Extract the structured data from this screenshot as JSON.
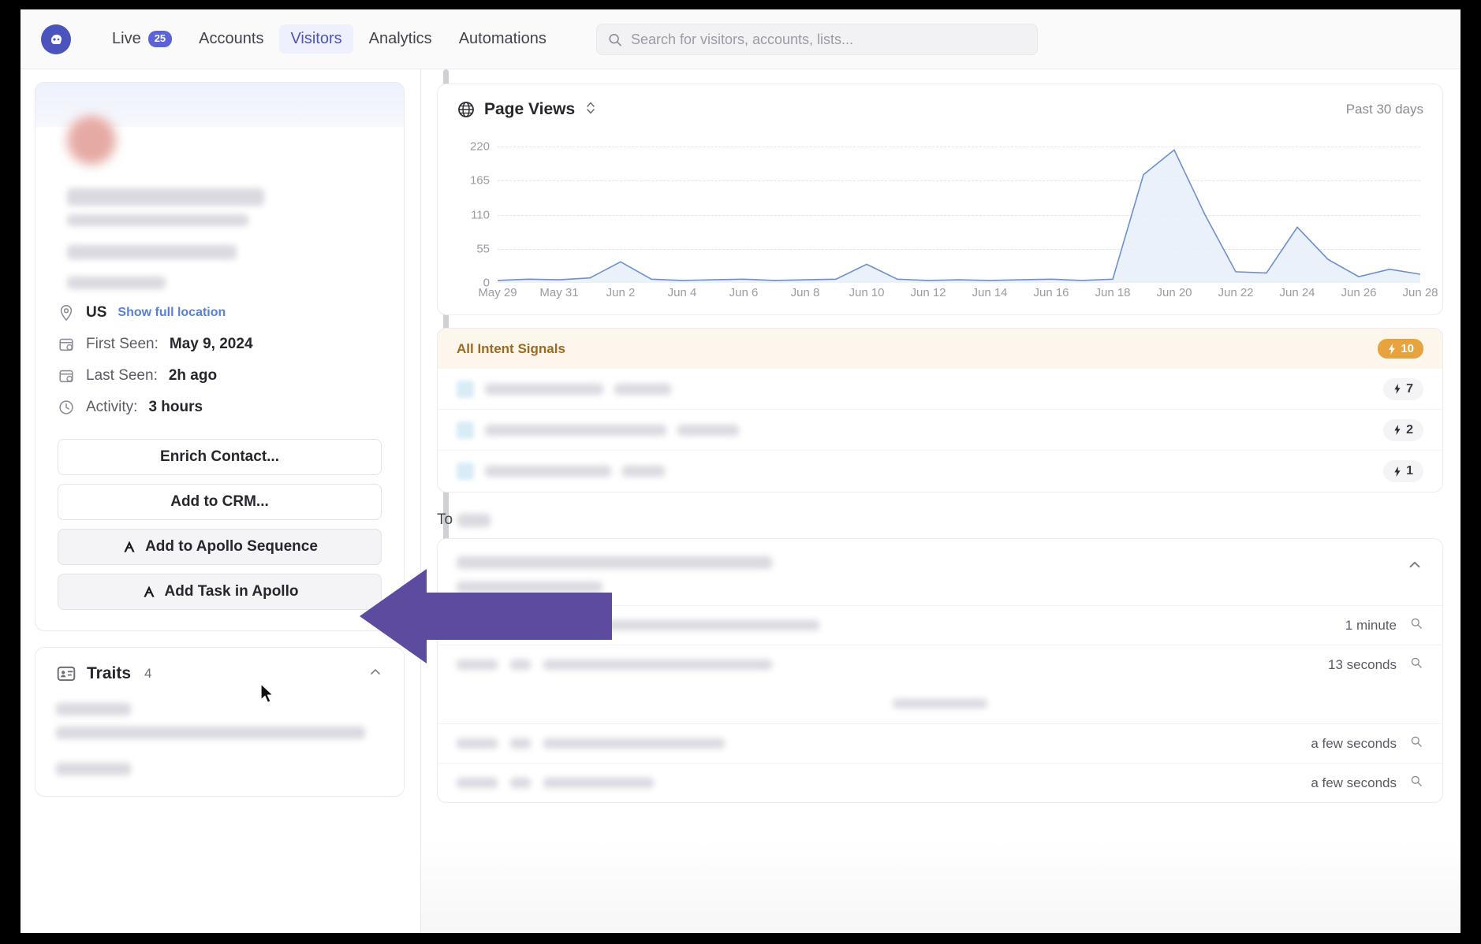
{
  "nav": {
    "logo_icon": "apollo-hippo-logo",
    "items": [
      {
        "label": "Live",
        "badge": "25",
        "active": false
      },
      {
        "label": "Accounts",
        "active": false
      },
      {
        "label": "Visitors",
        "active": true
      },
      {
        "label": "Analytics",
        "active": false
      },
      {
        "label": "Automations",
        "active": false
      }
    ],
    "search": {
      "icon": "search-icon",
      "placeholder": "Search for visitors, accounts, lists...",
      "value": ""
    }
  },
  "profile": {
    "location_icon": "map-pin-icon",
    "country": "US",
    "show_location_link": "Show full location",
    "first_seen_label": "First Seen:",
    "first_seen_value": "May 9, 2024",
    "last_seen_label": "Last Seen:",
    "last_seen_value": "2h ago",
    "activity_label": "Activity:",
    "activity_value": "3 hours",
    "calendar_icon": "calendar-clock-icon",
    "clock_icon": "clock-icon"
  },
  "actions": [
    {
      "label": "Enrich Contact...",
      "icon": null,
      "shaded": false
    },
    {
      "label": "Add to CRM...",
      "icon": null,
      "shaded": false
    },
    {
      "label": "Add to Apollo Sequence",
      "icon": "apollo-logo-icon",
      "shaded": true
    },
    {
      "label": "Add Task in Apollo",
      "icon": "apollo-logo-icon",
      "shaded": true
    }
  ],
  "traits": {
    "icon": "contact-card-icon",
    "title": "Traits",
    "count": "4",
    "collapse_icon": "chevron-up-icon"
  },
  "chart_card": {
    "icon": "globe-icon",
    "title": "Page Views",
    "sort_icon": "chevron-updown-icon",
    "range_label": "Past 30 days"
  },
  "chart_data": {
    "type": "area",
    "title": "Page Views",
    "subtitle": "Past 30 days",
    "xlabel": "",
    "ylabel": "",
    "ylim": [
      0,
      242
    ],
    "yticks": [
      0,
      55,
      110,
      165,
      220
    ],
    "grid": true,
    "legend": "none",
    "line_color": "#6c8fd0",
    "fill_color": "#e8eef9",
    "categories": [
      "May 29",
      "May 30",
      "May 31",
      "Jun 1",
      "Jun 2",
      "Jun 3",
      "Jun 4",
      "Jun 5",
      "Jun 6",
      "Jun 7",
      "Jun 8",
      "Jun 9",
      "Jun 10",
      "Jun 11",
      "Jun 12",
      "Jun 13",
      "Jun 14",
      "Jun 15",
      "Jun 16",
      "Jun 17",
      "Jun 18",
      "Jun 19",
      "Jun 20",
      "Jun 21",
      "Jun 22",
      "Jun 23",
      "Jun 24",
      "Jun 25",
      "Jun 26",
      "Jun 27",
      "Jun 28"
    ],
    "tick_labels": [
      "May 29",
      "May 31",
      "Jun 2",
      "Jun 4",
      "Jun 6",
      "Jun 8",
      "Jun 10",
      "Jun 12",
      "Jun 14",
      "Jun 16",
      "Jun 18",
      "Jun 20",
      "Jun 22",
      "Jun 24",
      "Jun 26",
      "Jun 28"
    ],
    "values": [
      4,
      6,
      5,
      8,
      34,
      6,
      4,
      5,
      6,
      4,
      5,
      6,
      30,
      6,
      4,
      5,
      4,
      5,
      6,
      4,
      6,
      175,
      215,
      110,
      18,
      16,
      90,
      38,
      10,
      22,
      14
    ]
  },
  "intent": {
    "header_label": "All Intent Signals",
    "header_badge": "10",
    "bolt_icon": "lightning-bolt-icon",
    "rows": [
      {
        "count": "7"
      },
      {
        "count": "2"
      },
      {
        "count": "1"
      }
    ]
  },
  "todo": {
    "label": "To",
    "collapse_icon": "chevron-up-icon"
  },
  "activity": {
    "rows": [
      {
        "duration": "1 minute",
        "action_icon": "magnify-icon"
      },
      {
        "duration": "13 seconds",
        "action_icon": "magnify-icon"
      },
      {
        "duration": "a few seconds",
        "action_icon": "magnify-icon"
      },
      {
        "duration": "a few seconds",
        "action_icon": "magnify-icon"
      }
    ]
  },
  "annotation": {
    "arrow_color": "#5c4b9e",
    "arrow_direction": "left"
  }
}
